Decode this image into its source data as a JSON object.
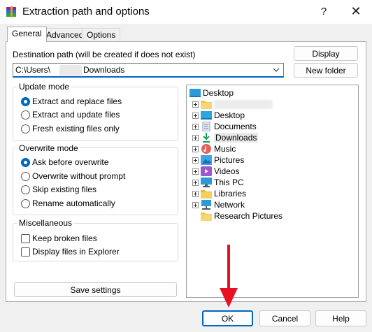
{
  "window": {
    "title": "Extraction path and options",
    "help_glyph": "?",
    "close_glyph": "✕"
  },
  "tabs": [
    {
      "label": "General",
      "active": true
    },
    {
      "label": "Advanced",
      "active": false
    },
    {
      "label": "Options",
      "active": false
    }
  ],
  "destination": {
    "label": "Destination path (will be created if does not exist)",
    "value_prefix": "C:\\Users\\",
    "value_suffix": "Downloads",
    "display_button": "Display",
    "new_folder_button": "New folder"
  },
  "update_mode": {
    "title": "Update mode",
    "options": [
      {
        "label": "Extract and replace files",
        "selected": true
      },
      {
        "label": "Extract and update files",
        "selected": false
      },
      {
        "label": "Fresh existing files only",
        "selected": false
      }
    ]
  },
  "overwrite_mode": {
    "title": "Overwrite mode",
    "options": [
      {
        "label": "Ask before overwrite",
        "selected": true
      },
      {
        "label": "Overwrite without prompt",
        "selected": false
      },
      {
        "label": "Skip existing files",
        "selected": false
      },
      {
        "label": "Rename automatically",
        "selected": false
      }
    ]
  },
  "misc": {
    "title": "Miscellaneous",
    "options": [
      {
        "label": "Keep broken files",
        "checked": false
      },
      {
        "label": "Display files in Explorer",
        "checked": false
      }
    ]
  },
  "save_settings_button": "Save settings",
  "tree": {
    "root": {
      "label": "Desktop",
      "icon": "desktop-icon"
    },
    "items": [
      {
        "label": "",
        "icon": "folder-icon",
        "expander": true
      },
      {
        "label": "Desktop",
        "icon": "desktop-icon",
        "expander": true
      },
      {
        "label": "Documents",
        "icon": "documents-icon",
        "expander": true
      },
      {
        "label": "Downloads",
        "icon": "downloads-icon",
        "expander": true,
        "selected": true
      },
      {
        "label": "Music",
        "icon": "music-icon",
        "expander": true
      },
      {
        "label": "Pictures",
        "icon": "pictures-icon",
        "expander": true
      },
      {
        "label": "Videos",
        "icon": "videos-icon",
        "expander": true
      },
      {
        "label": "This PC",
        "icon": "this-pc-icon",
        "expander": true
      },
      {
        "label": "Libraries",
        "icon": "folder-icon",
        "expander": true
      },
      {
        "label": "Network",
        "icon": "network-icon",
        "expander": true
      },
      {
        "label": "Research Pictures",
        "icon": "folder-icon",
        "expander": false
      }
    ]
  },
  "footer": {
    "ok": "OK",
    "cancel": "Cancel",
    "help": "Help"
  },
  "colors": {
    "accent": "#0067c0",
    "annotation_arrow": "#e81123"
  }
}
